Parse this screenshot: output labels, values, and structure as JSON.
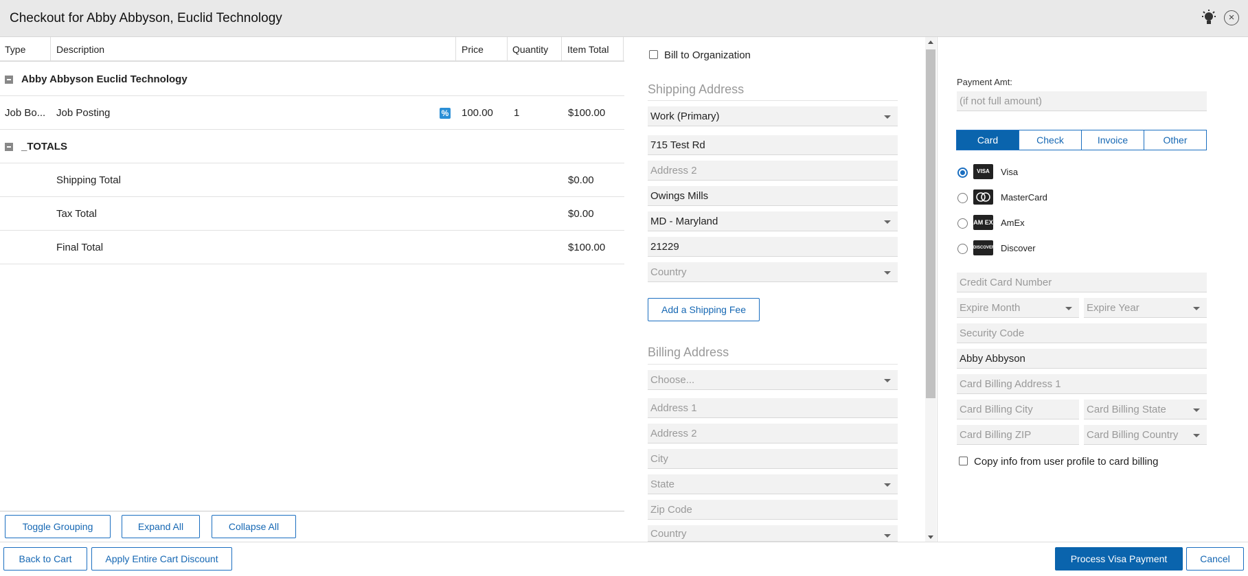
{
  "title": "Checkout for Abby Abbyson, Euclid Technology",
  "icons": {
    "bulb": "lightbulb-icon",
    "close": "close-icon"
  },
  "table": {
    "headers": {
      "type": "Type",
      "description": "Description",
      "price": "Price",
      "quantity": "Quantity",
      "item_total": "Item Total"
    },
    "group1": {
      "label": "Abby Abbyson Euclid Technology"
    },
    "item": {
      "type": "Job Bo...",
      "description": "Job Posting",
      "discount_icon": "%",
      "price": "100.00",
      "quantity": "1",
      "total": "$100.00"
    },
    "group2": {
      "label": "_TOTALS"
    },
    "totals": [
      {
        "label": "Shipping Total",
        "value": "$0.00"
      },
      {
        "label": "Tax Total",
        "value": "$0.00"
      },
      {
        "label": "Final Total",
        "value": "$100.00"
      }
    ]
  },
  "left_buttons": {
    "toggle": "Toggle Grouping",
    "expand": "Expand All",
    "collapse": "Collapse All"
  },
  "shipping": {
    "bill_to_org": "Bill to Organization",
    "heading": "Shipping Address",
    "address_type": "Work (Primary)",
    "address1": "715 Test Rd",
    "address2_placeholder": "Address 2",
    "city": "Owings Mills",
    "state": "MD - Maryland",
    "zip": "21229",
    "country_placeholder": "Country",
    "add_fee": "Add a Shipping Fee"
  },
  "billing": {
    "heading": "Billing Address",
    "choose": "Choose...",
    "address1": "Address 1",
    "address2": "Address 2",
    "city": "City",
    "state": "State",
    "zip": "Zip Code",
    "country": "Country"
  },
  "payment": {
    "amt_label": "Payment Amt:",
    "amt_placeholder": "(if not full amount)",
    "tabs": [
      "Card",
      "Check",
      "Invoice",
      "Other"
    ],
    "cards": [
      {
        "name": "Visa",
        "icon": "VISA",
        "selected": true
      },
      {
        "name": "MasterCard",
        "icon": "MC",
        "selected": false
      },
      {
        "name": "AmEx",
        "icon": "AMEX",
        "selected": false
      },
      {
        "name": "Discover",
        "icon": "DISCOVER",
        "selected": false
      }
    ],
    "cc_number": "Credit Card Number",
    "expire_month": "Expire Month",
    "expire_year": "Expire Year",
    "security_code": "Security Code",
    "card_name": "Abby Abbyson",
    "billing_address1": "Card Billing Address 1",
    "billing_city": "Card Billing City",
    "billing_state": "Card Billing State",
    "billing_zip": "Card Billing ZIP",
    "billing_country": "Card Billing Country",
    "copy_info": "Copy info from user profile to card billing"
  },
  "footer": {
    "back": "Back to Cart",
    "discount": "Apply Entire Cart Discount",
    "process": "Process Visa Payment",
    "cancel": "Cancel"
  }
}
